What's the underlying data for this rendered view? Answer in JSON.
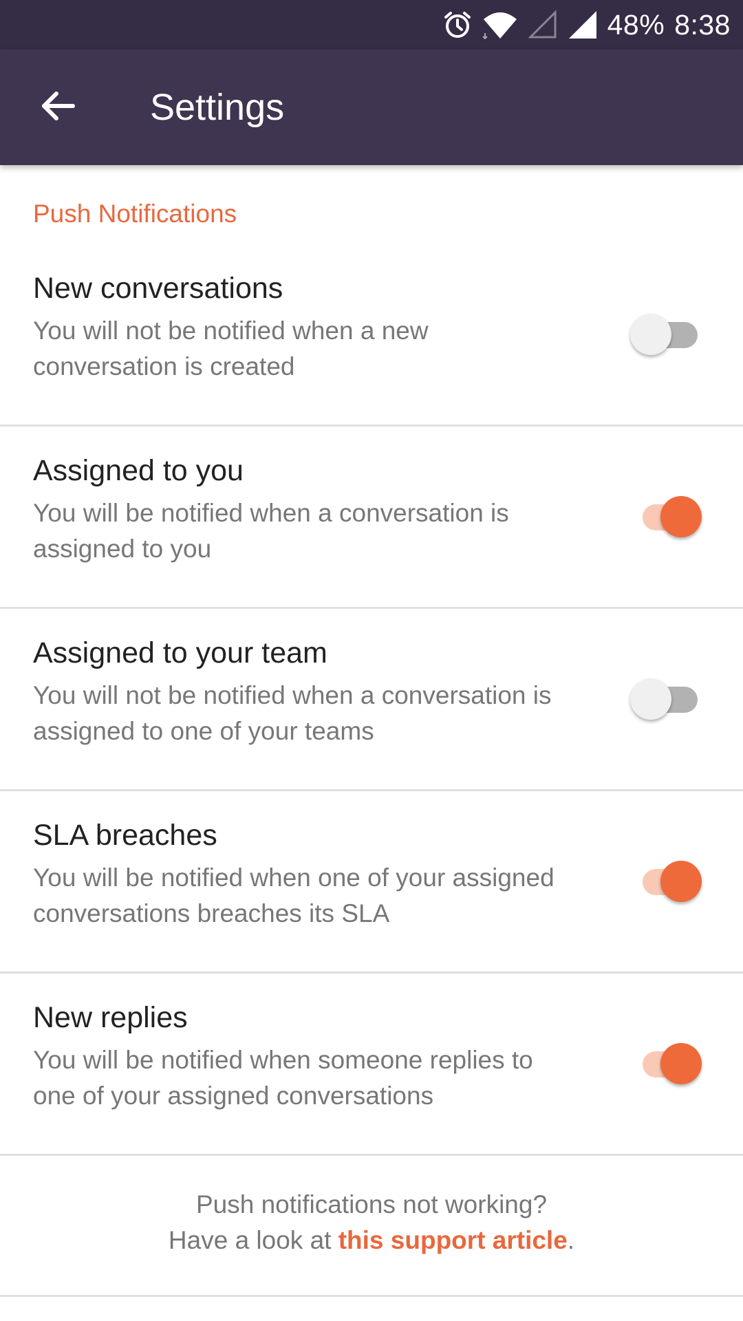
{
  "status_bar": {
    "battery": "48%",
    "time": "8:38",
    "icons": [
      "alarm-icon",
      "wifi-icon",
      "signal-empty-icon",
      "signal-full-icon"
    ]
  },
  "app_bar": {
    "title": "Settings",
    "back_icon": "arrow-left-icon",
    "background": "#403550"
  },
  "section": {
    "header": "Push Notifications",
    "accent_color": "#e8683d"
  },
  "settings": [
    {
      "title": "New conversations",
      "description": "You will not be notified when a new conversation is created",
      "enabled": false
    },
    {
      "title": "Assigned to you",
      "description": "You will be notified when a conversation is assigned to you",
      "enabled": true
    },
    {
      "title": "Assigned to your team",
      "description": "You will not be notified when a conversation is assigned to one of your teams",
      "enabled": false
    },
    {
      "title": "SLA breaches",
      "description": "You will be notified when one of your assigned conversations breaches its SLA",
      "enabled": true
    },
    {
      "title": "New replies",
      "description": "You will be notified when someone replies to one of your assigned conversations",
      "enabled": true
    }
  ],
  "footer": {
    "line1": "Push notifications not working?",
    "line2_prefix": "Have a look at ",
    "link_text": "this support article",
    "line2_suffix": "."
  }
}
